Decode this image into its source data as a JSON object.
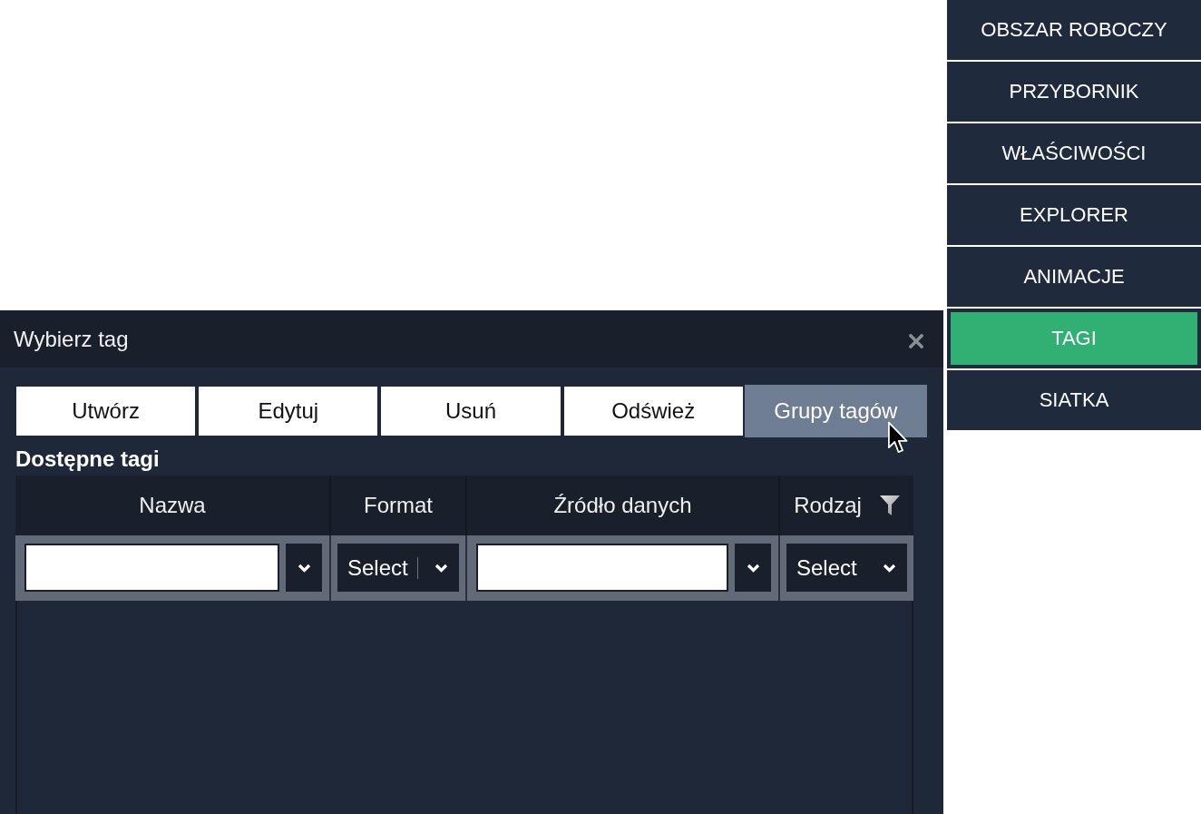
{
  "sidebar": {
    "items": [
      {
        "label": "OBSZAR ROBOCZY",
        "selected": false
      },
      {
        "label": "PRZYBORNIK",
        "selected": false
      },
      {
        "label": "WŁAŚCIWOŚCI",
        "selected": false
      },
      {
        "label": "EXPLORER",
        "selected": false
      },
      {
        "label": "ANIMACJE",
        "selected": false
      },
      {
        "label": "TAGI",
        "selected": true
      },
      {
        "label": "SIATKA",
        "selected": false
      }
    ]
  },
  "dialog": {
    "title": "Wybierz tag",
    "toolbar": {
      "buttons": [
        {
          "label": "Utwórz",
          "hovered": false
        },
        {
          "label": "Edytuj",
          "hovered": false
        },
        {
          "label": "Usuń",
          "hovered": false
        },
        {
          "label": "Odśwież",
          "hovered": false
        },
        {
          "label": "Grupy tagów",
          "hovered": true
        }
      ]
    },
    "section_title": "Dostępne tagi",
    "table": {
      "columns": [
        {
          "header": "Nazwa",
          "filter_icon": false,
          "filter": {
            "kind": "combo"
          }
        },
        {
          "header": "Format",
          "filter_icon": false,
          "filter": {
            "kind": "select",
            "value": "Select",
            "focused": true
          }
        },
        {
          "header": "Źródło danych",
          "filter_icon": false,
          "filter": {
            "kind": "combo"
          }
        },
        {
          "header": "Rodzaj",
          "filter_icon": true,
          "filter": {
            "kind": "select",
            "value": "Select",
            "focused": false
          }
        }
      ]
    }
  }
}
